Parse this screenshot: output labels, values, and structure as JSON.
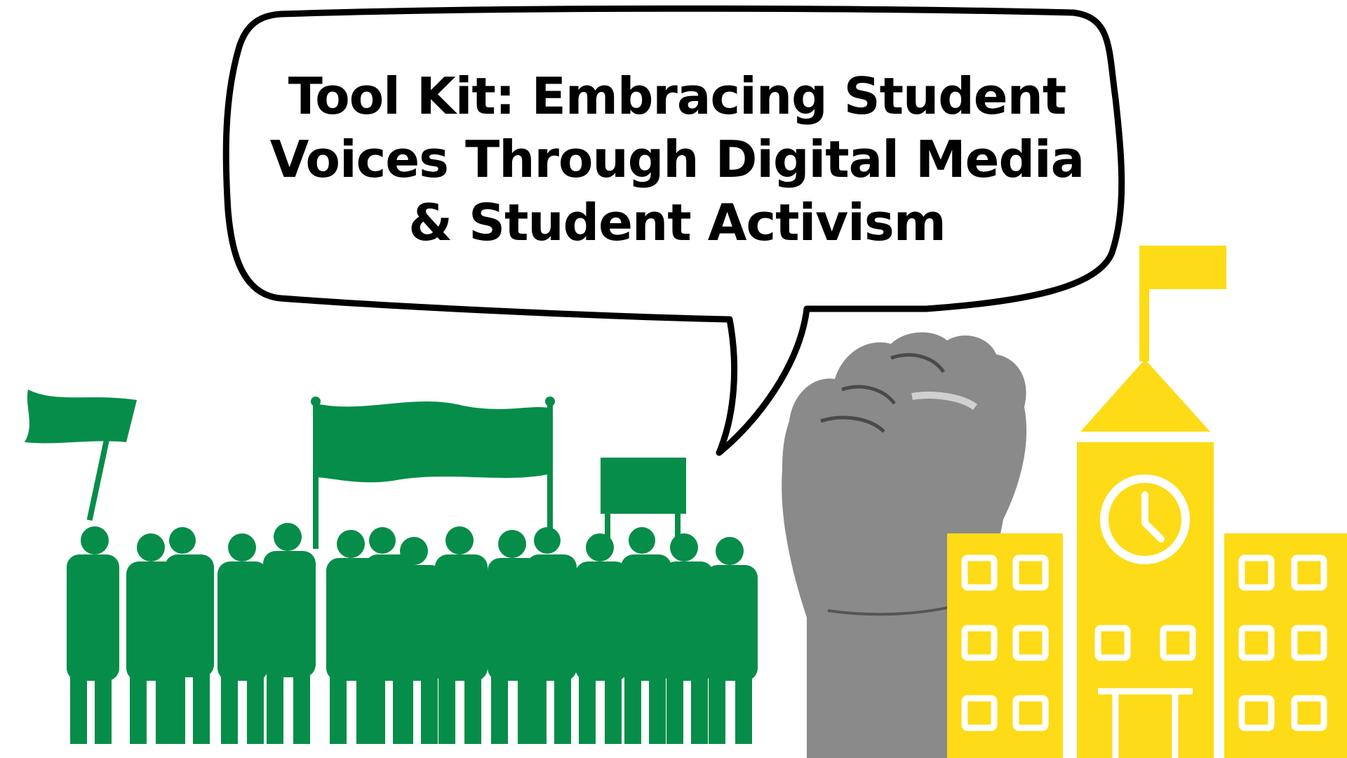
{
  "title": {
    "line1": "Tool Kit: Embracing Student",
    "line2": "Voices Through Digital Media",
    "line3": "& Student Activism"
  },
  "colors": {
    "crowd": "#068D49",
    "school": "#FDDB17",
    "bubble_outline": "#000000",
    "background": "#FFFFFF",
    "skin": "#8A8A8A"
  },
  "illustrations": {
    "left": "protest-crowd",
    "center": "raised-fist",
    "right": "school-building-with-clock-tower"
  }
}
